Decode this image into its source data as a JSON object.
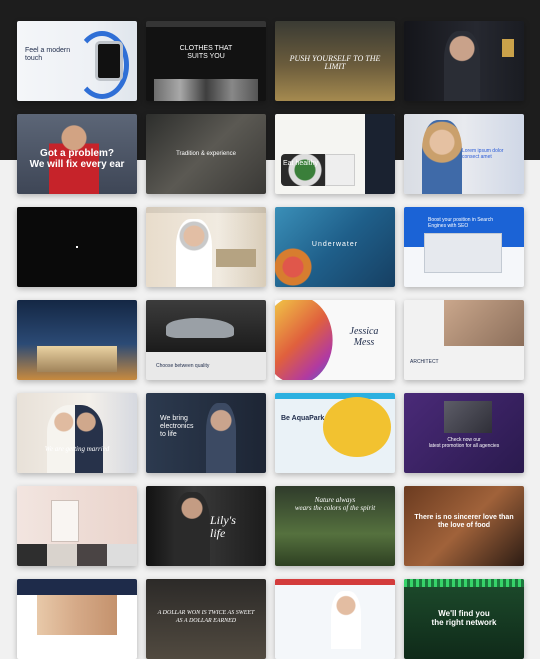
{
  "gallery": {
    "cards": [
      {
        "name": "tech-watch-theme",
        "text": "Feel a modern\ntouch"
      },
      {
        "name": "fashion-theme",
        "text": "CLOTHES THAT\nSUITS YOU"
      },
      {
        "name": "adventure-theme",
        "text": "PUSH YOURSELF TO THE LIMIT"
      },
      {
        "name": "author-theme",
        "text": ""
      },
      {
        "name": "plumber-theme",
        "text": "Got a problem?\nWe will fix every ear"
      },
      {
        "name": "interior-theme",
        "text": "Tradition & experience"
      },
      {
        "name": "restaurant-theme",
        "text": "Eat healthy"
      },
      {
        "name": "agency-theme",
        "text": "Lorem ipsum dolor\nconsect amet"
      },
      {
        "name": "dark-minimal-theme",
        "text": ""
      },
      {
        "name": "medical-theme",
        "text": ""
      },
      {
        "name": "underwater-theme",
        "text": "Underwater"
      },
      {
        "name": "seo-theme",
        "text": "Boost your position in Search\nEngines with SEO"
      },
      {
        "name": "real-estate-theme",
        "text": ""
      },
      {
        "name": "car-theme",
        "text": "Choose between quality"
      },
      {
        "name": "portfolio-theme",
        "text": "Jessica\nMess"
      },
      {
        "name": "architect-theme",
        "text": "ARCHITECT"
      },
      {
        "name": "wedding-theme",
        "text": "We are getting married"
      },
      {
        "name": "tech-company-theme",
        "text": "We bring\nelectronics\nto life"
      },
      {
        "name": "aquapark-theme",
        "text": "Be AquaPark"
      },
      {
        "name": "promo-theme",
        "text": "Check now our\nlatest promotion for all agencies"
      },
      {
        "name": "cosmetics-theme",
        "text": ""
      },
      {
        "name": "movie-theme",
        "text": "Lily's\nlife"
      },
      {
        "name": "nature-theme",
        "text": "Nature always\nwears the colors of the spirit"
      },
      {
        "name": "food-love-theme",
        "text": "There is no sincerer love than\nthe love of food"
      },
      {
        "name": "school-theme",
        "text": ""
      },
      {
        "name": "quote-theme",
        "text": "A DOLLAR WON IS TWICE AS SWEET\nAS A DOLLAR EARNED"
      },
      {
        "name": "clinic-theme",
        "text": ""
      },
      {
        "name": "business-theme",
        "text": "We'll find you\nthe right network"
      }
    ]
  }
}
